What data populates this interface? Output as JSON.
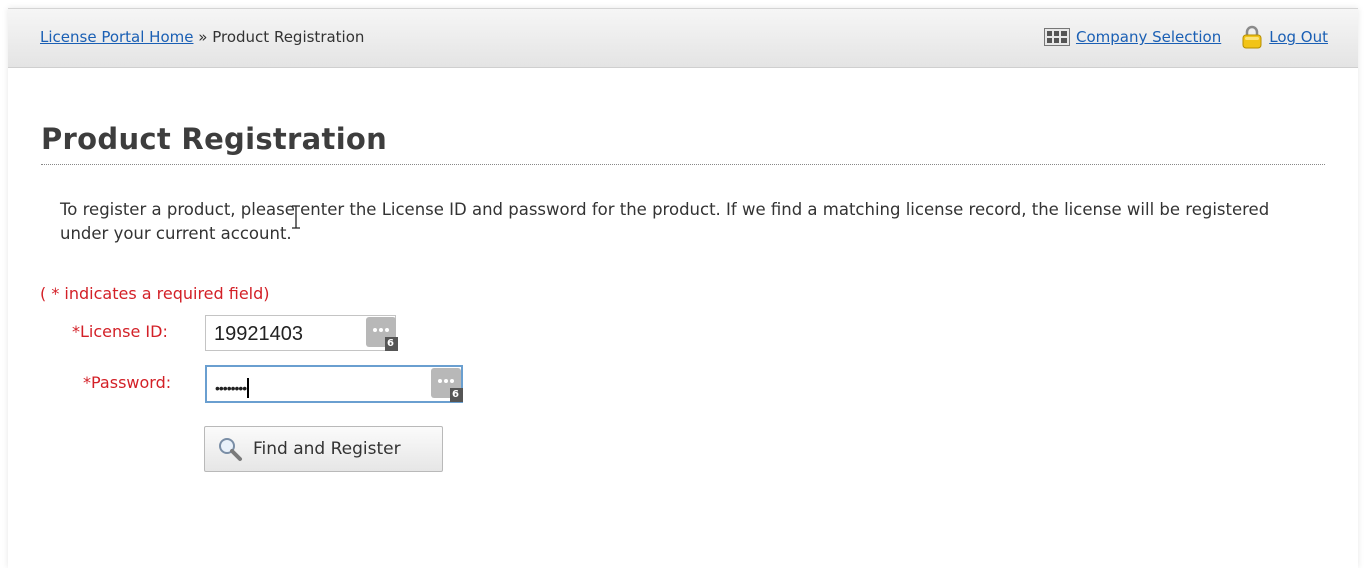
{
  "header": {
    "breadcrumb": {
      "home_link": "License Portal Home",
      "separator": "»",
      "current": "Product Registration"
    },
    "company_selection_label": "Company Selection",
    "logout_label": "Log Out"
  },
  "page": {
    "title": "Product Registration",
    "intro_text": "To register a product, please enter the License ID and password for the product. If we find a matching license record, the license will be registered under your current account.",
    "required_note": "( * indicates a required field)"
  },
  "form": {
    "license_id": {
      "label": "*License ID:",
      "value": "19921403",
      "manager_badge": "6"
    },
    "password": {
      "label": "*Password:",
      "masked_value": "••••••••",
      "manager_badge": "6"
    },
    "submit_label": "Find and Register"
  },
  "colors": {
    "link": "#1a5fb4",
    "required": "#d32027",
    "focus_border": "#6a9fd0"
  },
  "icons": {
    "company_selection": "grid-icon",
    "logout": "lock-icon",
    "password_manager": "password-manager-icon",
    "submit": "magnifier-icon"
  }
}
